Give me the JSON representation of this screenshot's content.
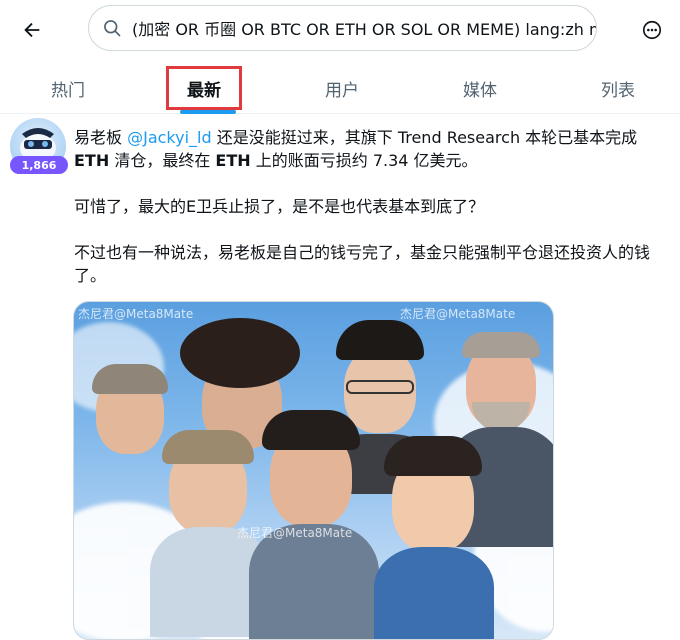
{
  "search": {
    "query": "(加密 OR 币圈 OR BTC OR ETH OR SOL OR MEME) lang:zh min_"
  },
  "icons": {
    "back": "arrow-left-icon",
    "search": "search-icon",
    "more": "more-icon"
  },
  "tabs": [
    {
      "label": "热门",
      "active": false
    },
    {
      "label": "最新",
      "active": true
    },
    {
      "label": "用户",
      "active": false
    },
    {
      "label": "媒体",
      "active": false
    },
    {
      "label": "列表",
      "active": false
    }
  ],
  "post": {
    "author_name": "易老板",
    "author_handle": "@Jackyi_ld",
    "badge_count": "1,866",
    "text_1_part1": " 还是没能挺过来，其旗下 Trend Research 本轮已基本完成",
    "text_1_bold1": "ETH",
    "text_1_part2": " 清仓，最终在 ",
    "text_1_bold2": "ETH",
    "text_1_part3": " 上的账面亏损约 7.34 亿美元。",
    "text_2": "可惜了，最大的E卫兵止损了，是不是也代表基本到底了？",
    "text_3": "不过也有一种说法，易老板是自己的钱亏完了，基金只能强制平仓退还投资人的钱了。"
  },
  "media": {
    "watermark": "杰尼君@Meta8Mate"
  },
  "colors": {
    "accent": "#1d9bf0",
    "highlight_box": "#e0393e",
    "badge": "#7856ff"
  }
}
